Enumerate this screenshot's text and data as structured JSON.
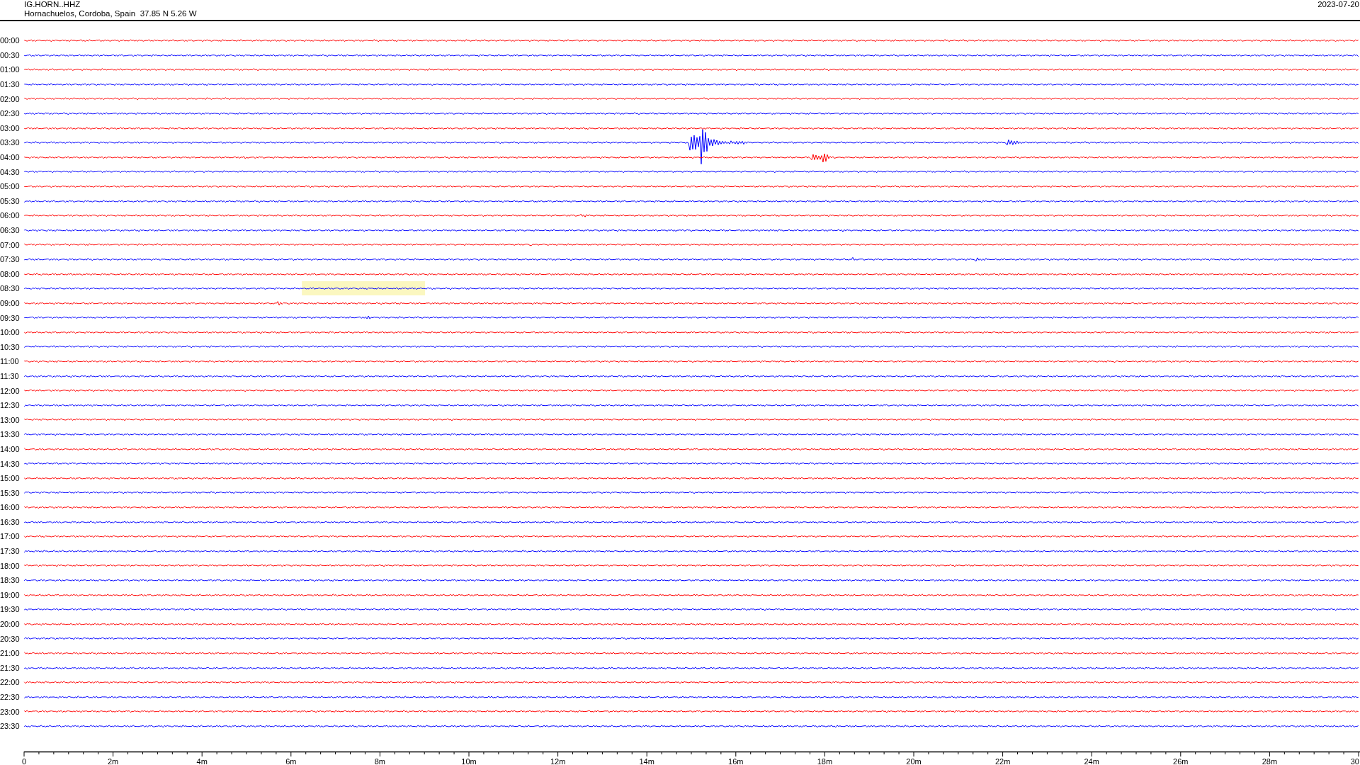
{
  "header": {
    "station": "IG.HORN..HHZ",
    "location": "Hornachuelos, Cordoba, Spain  37.85 N 5.26 W",
    "date": "2023-07-20"
  },
  "rows": [
    {
      "time": "00:00",
      "color": "#ff0000"
    },
    {
      "time": "00:30",
      "color": "#0000ff"
    },
    {
      "time": "01:00",
      "color": "#ff0000"
    },
    {
      "time": "01:30",
      "color": "#0000ff"
    },
    {
      "time": "02:00",
      "color": "#ff0000"
    },
    {
      "time": "02:30",
      "color": "#0000ff"
    },
    {
      "time": "03:00",
      "color": "#ff0000"
    },
    {
      "time": "03:30",
      "color": "#0000ff"
    },
    {
      "time": "04:00",
      "color": "#ff0000"
    },
    {
      "time": "04:30",
      "color": "#0000ff"
    },
    {
      "time": "05:00",
      "color": "#ff0000"
    },
    {
      "time": "05:30",
      "color": "#0000ff"
    },
    {
      "time": "06:00",
      "color": "#ff0000"
    },
    {
      "time": "06:30",
      "color": "#0000ff"
    },
    {
      "time": "07:00",
      "color": "#ff0000"
    },
    {
      "time": "07:30",
      "color": "#0000ff"
    },
    {
      "time": "08:00",
      "color": "#ff0000"
    },
    {
      "time": "08:30",
      "color": "#0000ff"
    },
    {
      "time": "09:00",
      "color": "#ff0000"
    },
    {
      "time": "09:30",
      "color": "#0000ff"
    },
    {
      "time": "10:00",
      "color": "#ff0000"
    },
    {
      "time": "10:30",
      "color": "#0000ff"
    },
    {
      "time": "11:00",
      "color": "#ff0000"
    },
    {
      "time": "11:30",
      "color": "#0000ff"
    },
    {
      "time": "12:00",
      "color": "#ff0000"
    },
    {
      "time": "12:30",
      "color": "#0000ff"
    },
    {
      "time": "13:00",
      "color": "#ff0000"
    },
    {
      "time": "13:30",
      "color": "#0000ff"
    },
    {
      "time": "14:00",
      "color": "#ff0000"
    },
    {
      "time": "14:30",
      "color": "#0000ff"
    },
    {
      "time": "15:00",
      "color": "#ff0000"
    },
    {
      "time": "15:30",
      "color": "#0000ff"
    },
    {
      "time": "16:00",
      "color": "#ff0000"
    },
    {
      "time": "16:30",
      "color": "#0000ff"
    },
    {
      "time": "17:00",
      "color": "#ff0000"
    },
    {
      "time": "17:30",
      "color": "#0000ff"
    },
    {
      "time": "18:00",
      "color": "#ff0000"
    },
    {
      "time": "18:30",
      "color": "#0000ff"
    },
    {
      "time": "19:00",
      "color": "#ff0000"
    },
    {
      "time": "19:30",
      "color": "#0000ff"
    },
    {
      "time": "20:00",
      "color": "#ff0000"
    },
    {
      "time": "20:30",
      "color": "#0000ff"
    },
    {
      "time": "21:00",
      "color": "#ff0000"
    },
    {
      "time": "21:30",
      "color": "#0000ff"
    },
    {
      "time": "22:00",
      "color": "#ff0000"
    },
    {
      "time": "22:30",
      "color": "#0000ff"
    },
    {
      "time": "23:00",
      "color": "#ff0000"
    },
    {
      "time": "23:30",
      "color": "#0000ff"
    }
  ],
  "x_axis": {
    "labels": [
      "0",
      "2m",
      "4m",
      "6m",
      "8m",
      "10m",
      "12m",
      "14m",
      "16m",
      "18m",
      "20m",
      "22m",
      "24m",
      "26m",
      "28m",
      "30"
    ]
  }
}
